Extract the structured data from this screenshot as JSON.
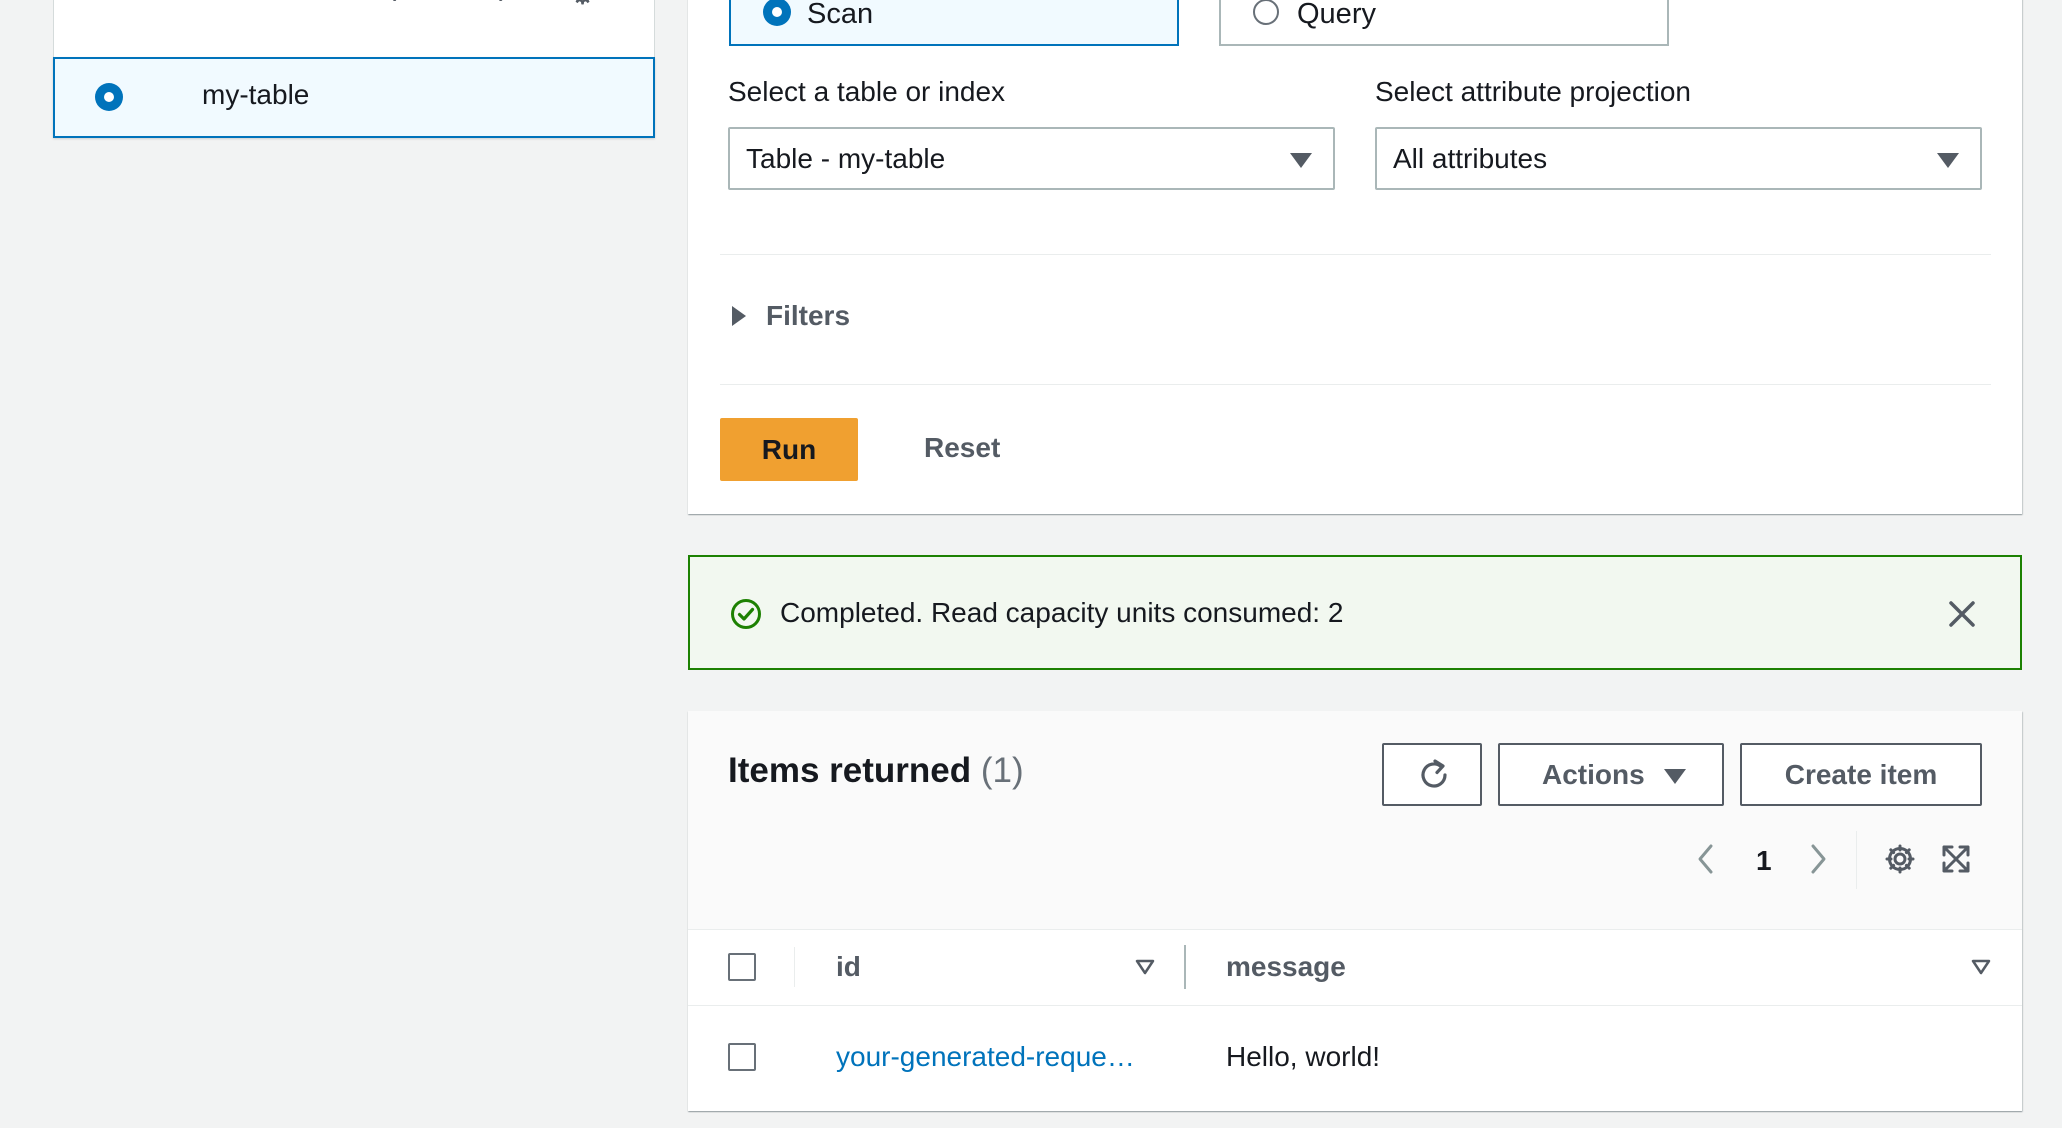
{
  "left_panel": {
    "table_row": {
      "label": "my-table",
      "selected": true
    }
  },
  "query_form": {
    "mode_tiles": [
      {
        "label": "Scan",
        "selected": true
      },
      {
        "label": "Query",
        "selected": false
      }
    ],
    "table_select": {
      "label": "Select a table or index",
      "value": "Table - my-table"
    },
    "projection_select": {
      "label": "Select attribute projection",
      "value": "All attributes"
    },
    "filters_label": "Filters",
    "run_label": "Run",
    "reset_label": "Reset"
  },
  "flash": {
    "message": "Completed. Read capacity units consumed: 2",
    "type": "success"
  },
  "results": {
    "title": "Items returned",
    "count": "(1)",
    "actions_label": "Actions",
    "create_label": "Create item",
    "page": "1",
    "columns": [
      "id",
      "message"
    ],
    "rows": [
      {
        "id": "your-generated-reque…",
        "message": "Hello, world!"
      }
    ]
  },
  "colors": {
    "accent": "#0073bb",
    "primary_button": "#f0a030",
    "success": "#1d8102",
    "success_bg": "#f2f8f0"
  }
}
